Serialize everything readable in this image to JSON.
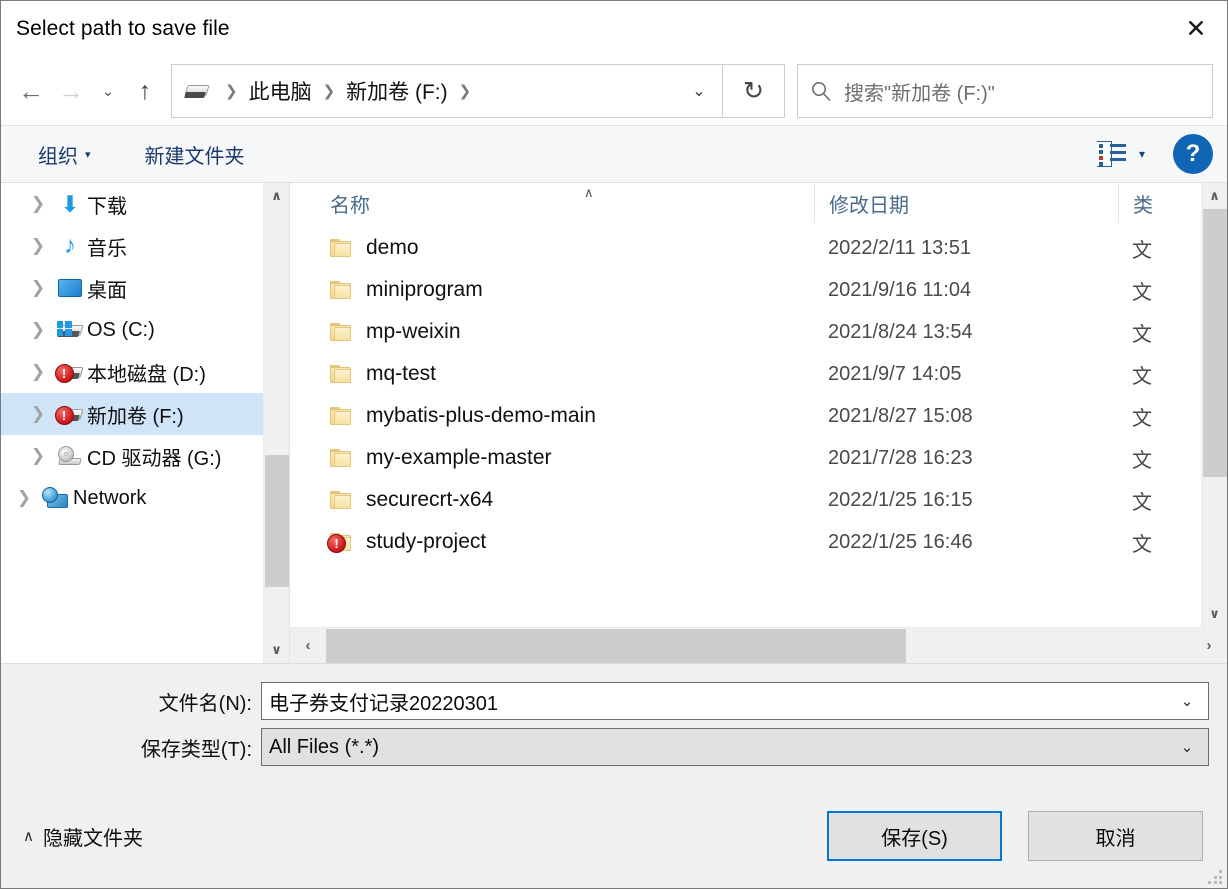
{
  "window": {
    "title": "Select path to save file",
    "close_label": "✕"
  },
  "nav": {
    "back_icon": "←",
    "forward_icon": "→",
    "recent_icon": "⌄",
    "up_icon": "↑",
    "refresh_icon": "↻",
    "dropdown_icon": "⌄"
  },
  "address": {
    "drive_icon": "drive-icon",
    "separator": "❯",
    "crumbs": [
      "此电脑",
      "新加卷 (F:)"
    ]
  },
  "search": {
    "icon": "search-icon",
    "placeholder": "搜索\"新加卷 (F:)\""
  },
  "commandbar": {
    "organize_label": "组织",
    "organize_caret": "▾",
    "new_folder_label": "新建文件夹",
    "view_caret": "▾",
    "help_label": "?"
  },
  "sidebar": {
    "items": [
      {
        "label": "下载",
        "icon": "download-icon",
        "chevron": "❯",
        "selected": false,
        "root": false
      },
      {
        "label": "音乐",
        "icon": "music-icon",
        "chevron": "❯",
        "selected": false,
        "root": false
      },
      {
        "label": "桌面",
        "icon": "desktop-icon",
        "chevron": "❯",
        "selected": false,
        "root": false
      },
      {
        "label": "OS (C:)",
        "icon": "windows-drive-icon",
        "chevron": "❯",
        "selected": false,
        "root": false
      },
      {
        "label": "本地磁盘 (D:)",
        "icon": "warning-drive-icon",
        "chevron": "❯",
        "selected": false,
        "root": false
      },
      {
        "label": "新加卷 (F:)",
        "icon": "warning-drive-icon",
        "chevron": "❯",
        "selected": true,
        "root": false
      },
      {
        "label": "CD 驱动器 (G:)",
        "icon": "cd-drive-icon",
        "chevron": "❯",
        "selected": false,
        "root": false
      },
      {
        "label": "Network",
        "icon": "network-icon",
        "chevron": "❯",
        "selected": false,
        "root": true
      }
    ],
    "scroll_up_icon": "∧",
    "scroll_down_icon": "∨"
  },
  "filelist": {
    "sort_indicator": "∧",
    "columns": [
      "名称",
      "修改日期",
      "类型"
    ],
    "column_type_truncated": "类",
    "rows": [
      {
        "name": "demo",
        "date": "2022/2/11 13:51",
        "type": "文件夹",
        "type_visible": "文",
        "icon": "folder-icon"
      },
      {
        "name": "miniprogram",
        "date": "2021/9/16 11:04",
        "type": "文件夹",
        "type_visible": "文",
        "icon": "folder-icon"
      },
      {
        "name": "mp-weixin",
        "date": "2021/8/24 13:54",
        "type": "文件夹",
        "type_visible": "文",
        "icon": "folder-icon"
      },
      {
        "name": "mq-test",
        "date": "2021/9/7 14:05",
        "type": "文件夹",
        "type_visible": "文",
        "icon": "folder-icon"
      },
      {
        "name": "mybatis-plus-demo-main",
        "date": "2021/8/27 15:08",
        "type": "文件夹",
        "type_visible": "文",
        "icon": "folder-icon"
      },
      {
        "name": "my-example-master",
        "date": "2021/7/28 16:23",
        "type": "文件夹",
        "type_visible": "文",
        "icon": "folder-icon"
      },
      {
        "name": "securecrt-x64",
        "date": "2022/1/25 16:15",
        "type": "文件夹",
        "type_visible": "文",
        "icon": "folder-icon"
      },
      {
        "name": "study-project",
        "date": "2022/1/25 16:46",
        "type": "文件夹",
        "type_visible": "文",
        "icon": "folder-warning-icon"
      }
    ],
    "h_left_icon": "‹",
    "h_right_icon": "›",
    "v_up_icon": "∧",
    "v_down_icon": "∨"
  },
  "form": {
    "filename_label": "文件名(N):",
    "filename_value": "电子券支付记录20220301",
    "filetype_label": "保存类型(T):",
    "filetype_value": "All Files (*.*)",
    "dropdown_icon": "⌄"
  },
  "footer": {
    "hide_folders_caret": "∧",
    "hide_folders_label": "隐藏文件夹",
    "save_label": "保存(S)",
    "cancel_label": "取消"
  },
  "colors": {
    "accent": "#0078d7",
    "selection": "#cfe4f7",
    "link": "#1b3a6b",
    "header_text": "#4a6b8a",
    "help_blue": "#1066b5"
  }
}
